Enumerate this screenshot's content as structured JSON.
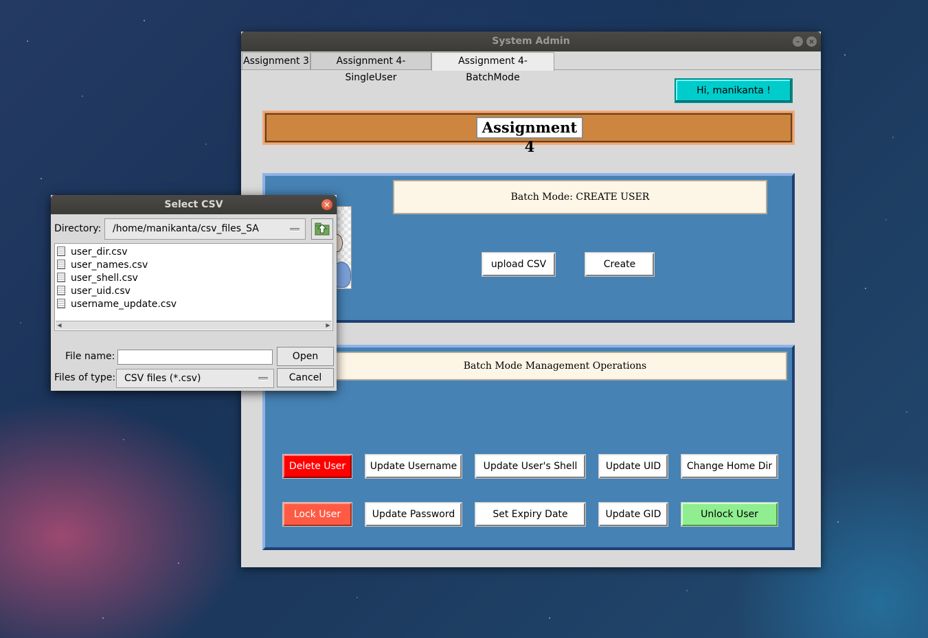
{
  "main_window": {
    "title": "System Admin",
    "tabs": [
      {
        "label": "Assignment 3"
      },
      {
        "label": "Assignment 4-SingleUser"
      },
      {
        "label": "Assignment 4-BatchMode"
      }
    ],
    "greeting": "Hi, manikanta !",
    "banner": "Assignment 4",
    "create_panel": {
      "header": "Batch Mode:  CREATE USER",
      "upload_button": "upload CSV",
      "create_button": "Create"
    },
    "ops_panel": {
      "header": "Batch Mode Management Operations",
      "row1": [
        "Delete User",
        "Update Username",
        "Update User's Shell",
        "Update UID",
        "Change Home Dir"
      ],
      "row2": [
        "Lock User",
        "Update Password",
        "Set Expiry Date",
        "Update GID",
        "Unlock User"
      ]
    },
    "colors": {
      "greeting_bg": "#00cccc",
      "banner_bg": "#cd853f",
      "panel_bg": "#4682b4",
      "delete_bg": "#ff0000",
      "lock_bg": "#ff5a43",
      "unlock_bg": "#90ee90"
    }
  },
  "dialog": {
    "title": "Select CSV",
    "directory_label": "Directory:",
    "directory_value": "/home/manikanta/csv_files_SA",
    "files": [
      "user_dir.csv",
      "user_names.csv",
      "user_shell.csv",
      "user_uid.csv",
      "username_update.csv"
    ],
    "file_name_label": "File name:",
    "file_name_value": "",
    "files_of_type_label": "Files of type:",
    "files_of_type_value": "CSV files (*.csv)",
    "open_button": "Open",
    "cancel_button": "Cancel",
    "icons": {
      "up_dir": "folder-up-icon",
      "close": "close-icon",
      "file": "file-icon"
    }
  }
}
